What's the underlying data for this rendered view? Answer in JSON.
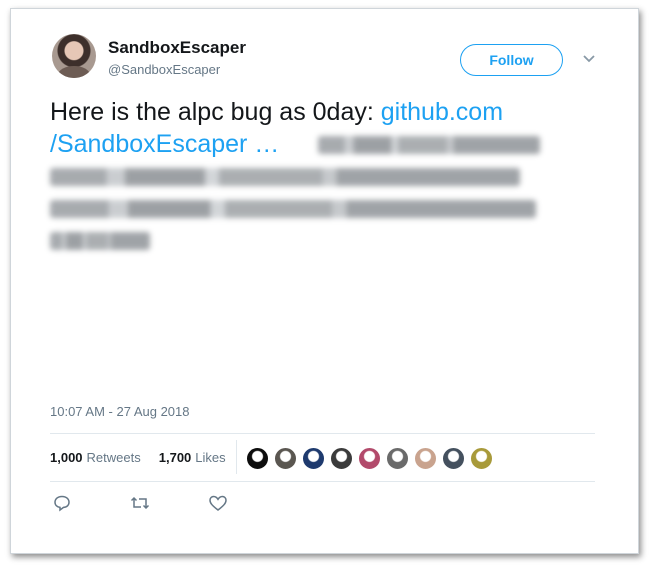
{
  "user": {
    "display_name": "SandboxEscaper",
    "handle": "@SandboxEscaper"
  },
  "follow_label": "Follow",
  "tweet": {
    "text_plain": "Here is the alpc bug as 0day: ",
    "link_line1": "github.com",
    "link_line2": "/SandboxEscaper …"
  },
  "timestamp": "10:07 AM - 27 Aug 2018",
  "stats": {
    "retweets_count": "1,000",
    "retweets_label": "Retweets",
    "likes_count": "1,700",
    "likes_label": "Likes"
  },
  "likers": [
    {
      "color": "#0d0d0d"
    },
    {
      "color": "#5a5650"
    },
    {
      "color": "#1e3a6e"
    },
    {
      "color": "#3b3b3b"
    },
    {
      "color": "#b24a6b"
    },
    {
      "color": "#6a6a6a"
    },
    {
      "color": "#c9a38e"
    },
    {
      "color": "#44505e"
    },
    {
      "color": "#a89a3a"
    }
  ],
  "icons": [
    "reply-icon",
    "retweet-icon",
    "like-icon",
    "chevron-down-icon"
  ],
  "colors": {
    "accent": "#1da1f2",
    "text": "#14171a",
    "muted": "#657786"
  }
}
